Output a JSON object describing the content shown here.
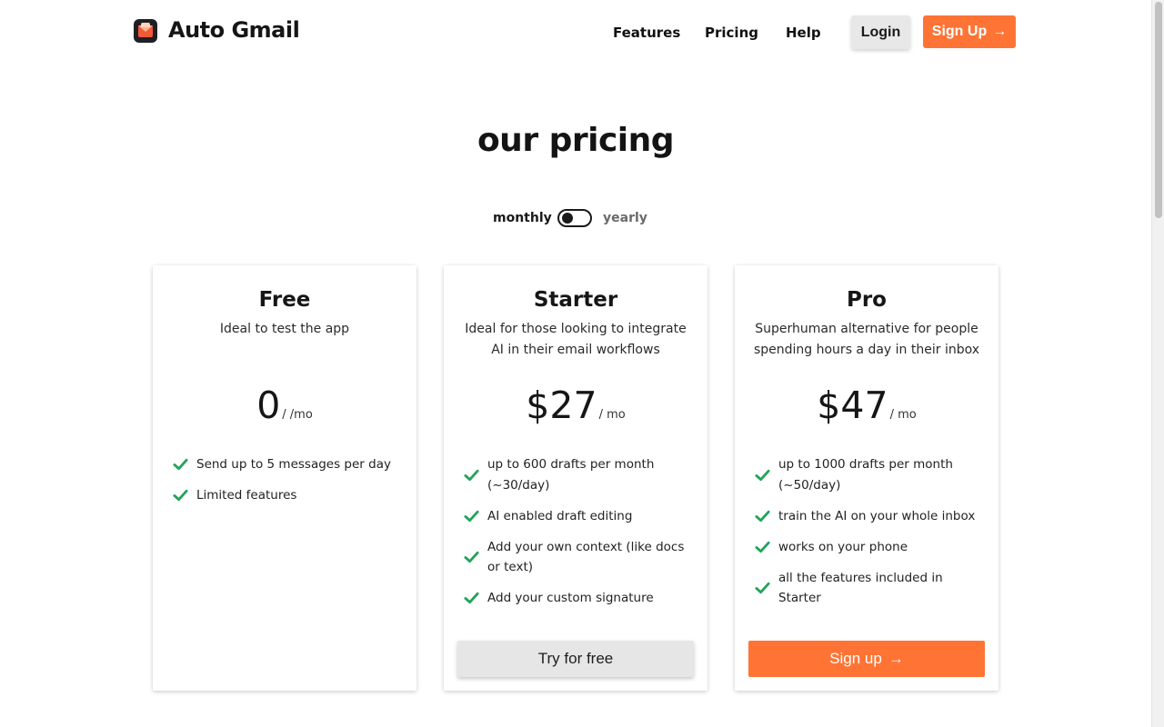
{
  "header": {
    "brand": "Auto Gmail",
    "nav": [
      "Features",
      "Pricing",
      "Help"
    ],
    "login_label": "Login",
    "signup_label": "Sign Up",
    "arrow_glyph": "→",
    "icons": {
      "logo": "mail-logo-icon",
      "arrow": "arrow-right-icon"
    },
    "colors": {
      "accent": "#ff7434",
      "login_bg": "#e8e8e8"
    }
  },
  "main": {
    "title": "our pricing",
    "billing": {
      "monthly_label": "monthly",
      "yearly_label": "yearly",
      "selected": "monthly"
    }
  },
  "plans": [
    {
      "name": "Free",
      "description": "Ideal to test the app",
      "price": "0",
      "period": "/ /mo",
      "features": [
        "Send up to 5 messages per day",
        "Limited features"
      ],
      "cta": null
    },
    {
      "name": "Starter",
      "description": "Ideal for those looking to integrate AI in their email workflows",
      "price": "$27",
      "period": "/ mo",
      "features": [
        "up to 600 drafts per month (~30/day)",
        "AI enabled draft editing",
        "Add your own context (like docs or text)",
        "Add your custom signature"
      ],
      "cta": "Try for free"
    },
    {
      "name": "Pro",
      "description": "Superhuman alternative for people spending hours a day in their inbox",
      "price": "$47",
      "period": "/ mo",
      "features": [
        "up to 1000 drafts per month (~50/day)",
        "train the AI on your whole inbox",
        "works on your phone",
        "all the features included in Starter"
      ],
      "cta": "Sign up"
    }
  ],
  "theme": {
    "check_color": "#22a35a",
    "text_color": "#1a1a1a"
  }
}
